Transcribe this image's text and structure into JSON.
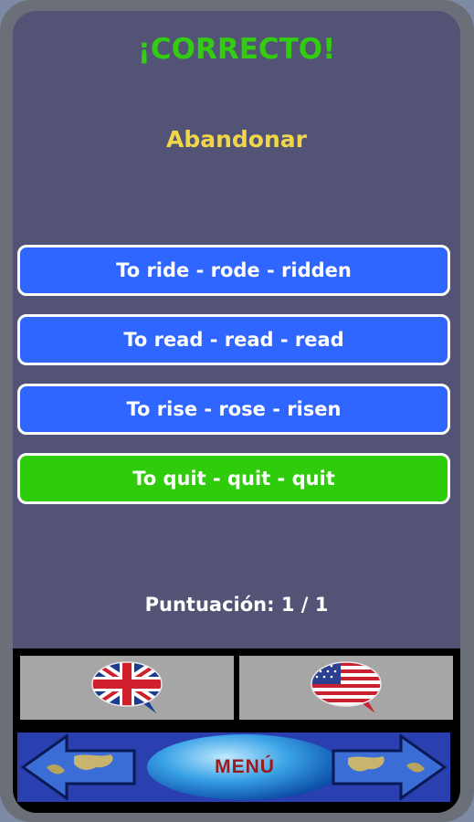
{
  "status": {
    "result": "¡CORRECTO!"
  },
  "question": {
    "word": "Abandonar"
  },
  "options": [
    {
      "label": "To ride - rode - ridden",
      "state": "default"
    },
    {
      "label": "To read - read - read",
      "state": "default"
    },
    {
      "label": "To rise - rose - risen",
      "state": "default"
    },
    {
      "label": "To quit - quit - quit",
      "state": "correct"
    }
  ],
  "score": {
    "label": "Puntuación: 1 / 1"
  },
  "language_buttons": [
    {
      "icon": "uk-flag-icon"
    },
    {
      "icon": "us-flag-icon"
    }
  ],
  "nav": {
    "menu_label": "MENÚ",
    "prev_icon": "arrow-left-icon",
    "next_icon": "arrow-right-icon"
  },
  "colors": {
    "background": "#525375",
    "option_default": "#2e66ff",
    "option_correct": "#2fcc0c",
    "result_text": "#33cc11",
    "word_text": "#f2d64a"
  }
}
